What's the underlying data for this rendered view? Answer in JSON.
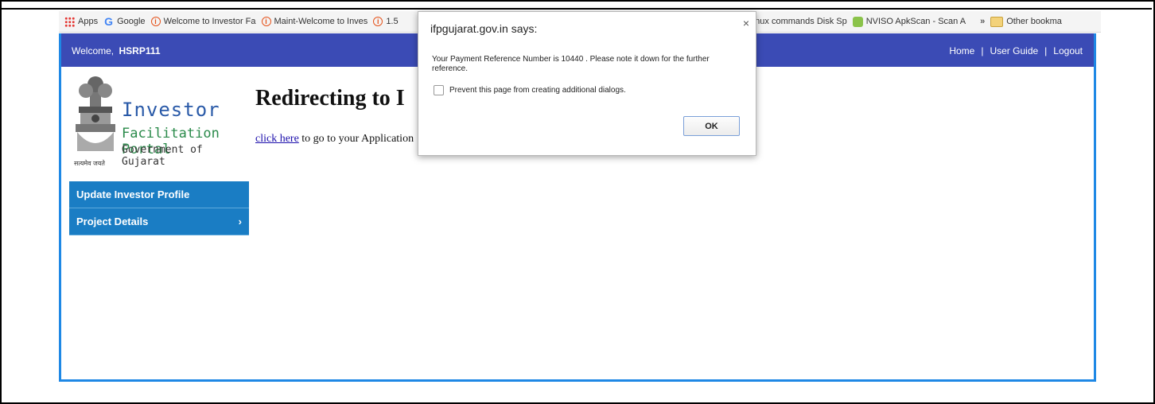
{
  "bookmarks": [
    {
      "icon": "apps-grid-icon",
      "label": "Apps"
    },
    {
      "icon": "google-icon",
      "label": "Google"
    },
    {
      "icon": "welcome-site-icon",
      "label": "Welcome to Investor Fa"
    },
    {
      "icon": "welcome-site-icon",
      "label": "Maint-Welcome to Inves"
    },
    {
      "icon": "welcome-site-icon",
      "label": "1.5"
    },
    {
      "icon": "linux-icon",
      "label": "Linux commands Disk Sp"
    },
    {
      "icon": "android-icon",
      "label": "NVISO ApkScan - Scan A"
    },
    {
      "icon": "overflow-chevron-icon",
      "label": "»"
    },
    {
      "icon": "folder-icon",
      "label": "Other bookma"
    }
  ],
  "header": {
    "welcome_label": "Welcome,",
    "username": "HSRP111",
    "links": [
      "Home",
      "User Guide",
      "Logout"
    ],
    "separator": "|",
    "bg_color": "#3b4bb5"
  },
  "logo": {
    "line1": "Investor",
    "line2": "Facilitation Portal",
    "line3": "Government of Gujarat",
    "motto": "सत्यमेव जयते"
  },
  "menu": [
    {
      "label": "Update Investor Profile",
      "has_submenu": false
    },
    {
      "label": "Project Details",
      "has_submenu": true,
      "chevron": "›"
    }
  ],
  "content": {
    "heading": "Redirecting to I",
    "link_text": "click here",
    "line_rest": " to go to your Application"
  },
  "dialog": {
    "title": "ifpgujarat.gov.in says:",
    "close_glyph": "×",
    "message": "Your Payment Reference Number is 10440 . Please note it down for the further reference.",
    "checkbox_label": "Prevent this page from creating additional dialogs.",
    "checkbox_checked": false,
    "ok_label": "OK"
  }
}
